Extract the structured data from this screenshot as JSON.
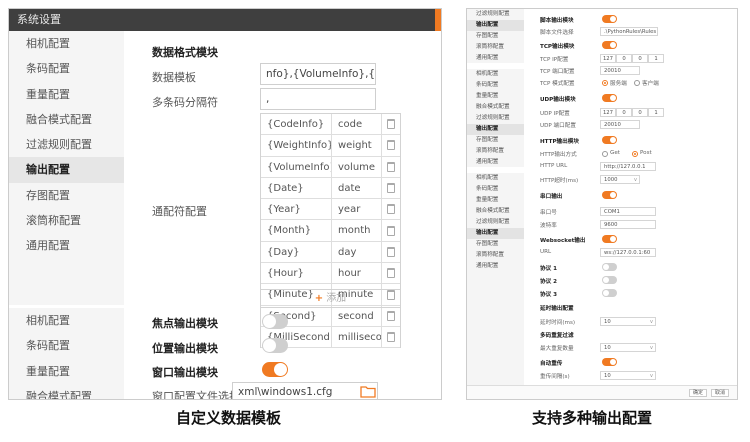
{
  "left": {
    "window_title": "系统设置",
    "nav_top": [
      "相机配置",
      "条码配置",
      "重量配置",
      "融合模式配置",
      "过滤规则配置",
      "输出配置",
      "存图配置",
      "滚筒称配置",
      "通用配置"
    ],
    "nav_bottom": [
      "相机配置",
      "条码配置",
      "重量配置",
      "融合模式配置"
    ],
    "active_nav": "输出配置",
    "section_title": "数据格式模块",
    "template_label": "数据模板",
    "template_value": "nfo},{VolumeInfo},{Date}",
    "separator_label": "多条码分隔符",
    "separator_value": ",",
    "wildcard_label": "通配符配置",
    "wildcards": [
      {
        "token": "{CodeInfo}",
        "name": "code"
      },
      {
        "token": "{WeightInfo}",
        "name": "weight"
      },
      {
        "token": "{VolumeInfo}",
        "name": "volume"
      },
      {
        "token": "{Date}",
        "name": "date"
      },
      {
        "token": "{Year}",
        "name": "year"
      },
      {
        "token": "{Month}",
        "name": "month"
      },
      {
        "token": "{Day}",
        "name": "day"
      },
      {
        "token": "{Hour}",
        "name": "hour"
      },
      {
        "token": "{Minute}",
        "name": "minute"
      },
      {
        "token": "{Second}",
        "name": "second"
      },
      {
        "token": "{MilliSecond}",
        "name": "millisecon"
      }
    ],
    "add_label": "添加",
    "focus_output_label": "焦点输出模块",
    "focus_output_on": false,
    "position_output_label": "位置输出模块",
    "position_output_on": false,
    "window_output_label": "窗口输出模块",
    "window_output_on": true,
    "window_config_label": "窗口配置文件选择",
    "window_config_value": "xml\\windows1.cfg"
  },
  "right": {
    "nav_top": [
      "过滤规则配置",
      "输出配置",
      "存图配置",
      "滚筒称配置",
      "通用配置"
    ],
    "nav_mid": [
      "相机配置",
      "条码配置",
      "重量配置",
      "融合模式配置",
      "过滤规则配置",
      "输出配置",
      "存图配置",
      "滚筒称配置",
      "通用配置"
    ],
    "nav_bottom": [
      "相机配置",
      "条码配置",
      "重量配置",
      "融合模式配置",
      "过滤规则配置",
      "输出配置",
      "存图配置",
      "滚筒称配置",
      "通用配置"
    ],
    "script_module": "脚本输出模块",
    "script_file_label": "脚本文件选择",
    "script_file_value": ".\\PythonRules\\Rules",
    "tcp_output": "TCP输出模块",
    "tcp_ip_label": "TCP IP配置",
    "tcp_ip": [
      "127",
      "0",
      "0",
      "1"
    ],
    "tcp_port_label": "TCP 端口配置",
    "tcp_port": "20010",
    "tcp_mode_label": "TCP 模式配置",
    "tcp_mode_server": "服务端",
    "tcp_mode_client": "客户端",
    "udp_output": "UDP输出模块",
    "udp_ip_label": "UDP IP配置",
    "udp_ip": [
      "127",
      "0",
      "0",
      "1"
    ],
    "udp_port_label": "UDP 端口配置",
    "udp_port": "20010",
    "http_output": "HTTP输出模块",
    "http_mode_label": "HTTP输出方式",
    "http_get": "Get",
    "http_post": "Post",
    "http_url_label": "HTTP URL",
    "http_url": "http://127.0.0.1",
    "http_timeout_label": "HTTP超时(ms)",
    "http_timeout": "1000",
    "serial_output": "串口输出",
    "serial_port_label": "串口号",
    "serial_port": "COM1",
    "baud_label": "波特率",
    "baud": "9600",
    "ws_output": "Websocket输出",
    "ws_url_label": "URL",
    "ws_url": "ws://127.0.0.1:60",
    "protocol1": "协议 1",
    "protocol2": "协议 2",
    "protocol3": "协议 3",
    "delay_output": "延时输出配置",
    "delay_time_label": "延时时间(ms)",
    "delay_time": "10",
    "multi_filter": "多码重复过滤",
    "max_repeat_label": "最大重复数量",
    "max_repeat": "10",
    "auto_reset": "自动重传",
    "reset_interval_label": "重传间隔(s)",
    "reset_interval": "10",
    "btn_ok": "确定",
    "btn_cancel": "取消"
  },
  "captions": {
    "left": "自定义数据模板",
    "right": "支持多种输出配置"
  },
  "colors": {
    "accent": "#f07a22",
    "titlebar": "#3f3f3f",
    "nav_bg": "#f5f5f5"
  }
}
